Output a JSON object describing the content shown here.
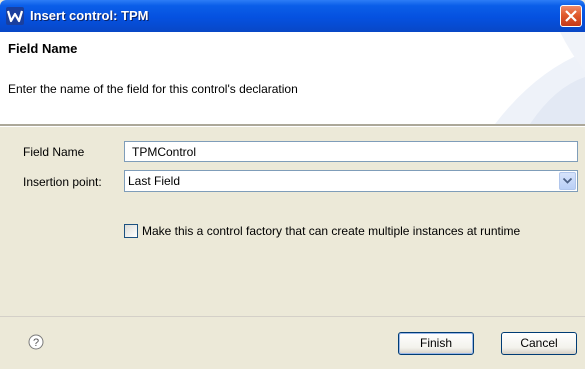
{
  "window": {
    "title": "Insert control: TPM",
    "app_icon": "w-logo-icon",
    "close_icon": "close-icon"
  },
  "banner": {
    "title": "Field Name",
    "description": "Enter the name of the field for this control's declaration"
  },
  "form": {
    "field_name_label": "Field Name",
    "field_name_value": "TPMControl",
    "insertion_point_label": "Insertion point:",
    "insertion_point_value": "Last Field",
    "factory_checkbox_label": "Make this a control factory that can create multiple instances at runtime",
    "factory_checked": false
  },
  "footer": {
    "help_icon": "help-icon",
    "finish_label": "Finish",
    "cancel_label": "Cancel"
  },
  "colors": {
    "titlebar": "#0551e0",
    "dialog_bg": "#ece9d8",
    "close_button": "#e05a2c"
  }
}
